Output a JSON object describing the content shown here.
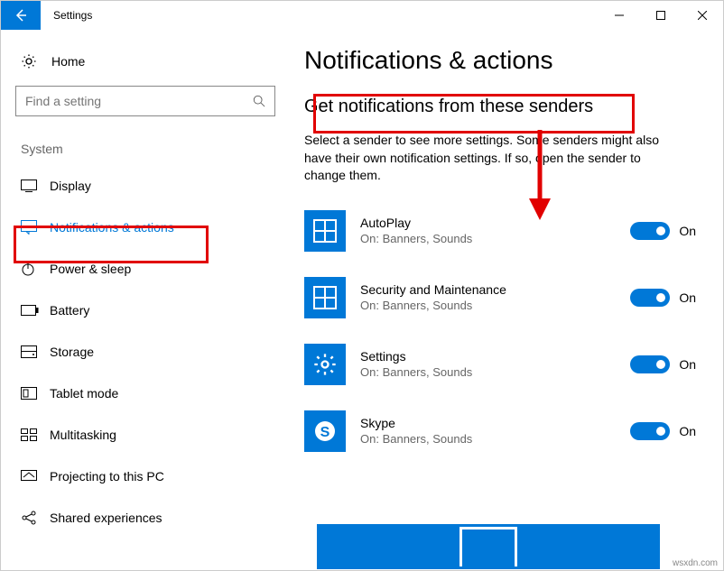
{
  "window": {
    "title": "Settings"
  },
  "sidebar": {
    "home": "Home",
    "search_placeholder": "Find a setting",
    "group": "System",
    "items": [
      {
        "label": "Display"
      },
      {
        "label": "Notifications & actions"
      },
      {
        "label": "Power & sleep"
      },
      {
        "label": "Battery"
      },
      {
        "label": "Storage"
      },
      {
        "label": "Tablet mode"
      },
      {
        "label": "Multitasking"
      },
      {
        "label": "Projecting to this PC"
      },
      {
        "label": "Shared experiences"
      }
    ]
  },
  "main": {
    "title": "Notifications & actions",
    "subtitle": "Get notifications from these senders",
    "instruction": "Select a sender to see more settings. Some senders might also have their own notification settings. If so, open the sender to change them.",
    "senders": [
      {
        "name": "AutoPlay",
        "detail": "On: Banners, Sounds",
        "state": "On"
      },
      {
        "name": "Security and Maintenance",
        "detail": "On: Banners, Sounds",
        "state": "On"
      },
      {
        "name": "Settings",
        "detail": "On: Banners, Sounds",
        "state": "On"
      },
      {
        "name": "Skype",
        "detail": "On: Banners, Sounds",
        "state": "On"
      }
    ]
  },
  "credit": "wsxdn.com"
}
